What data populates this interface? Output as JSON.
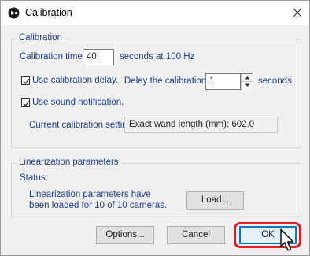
{
  "window": {
    "title": "Calibration"
  },
  "calibration_group": {
    "title": "Calibration",
    "time_label": "Calibration time",
    "time_value": "40",
    "time_suffix": "seconds at 100 Hz",
    "delay_checkbox": {
      "label": "Use calibration delay.",
      "checked": true
    },
    "delay_label": "Delay the calibration",
    "delay_value": "1",
    "delay_suffix": "seconds.",
    "sound_checkbox": {
      "label": "Use sound notification.",
      "checked": true
    },
    "current_settings_label": "Current calibration settings:",
    "current_settings_value": "Exact wand length (mm): 602.0"
  },
  "linearization_group": {
    "title": "Linearization parameters",
    "status_label": "Status:",
    "status_line1": "Linearization parameters have",
    "status_line2": "been loaded for 10 of 10 cameras.",
    "load_button": "Load..."
  },
  "footer": {
    "options_button": "Options...",
    "cancel_button": "Cancel",
    "ok_button": "OK"
  },
  "colors": {
    "group_title": "#1f3c8a",
    "default_button_border": "#0078d7",
    "highlight": "#e01c24"
  }
}
